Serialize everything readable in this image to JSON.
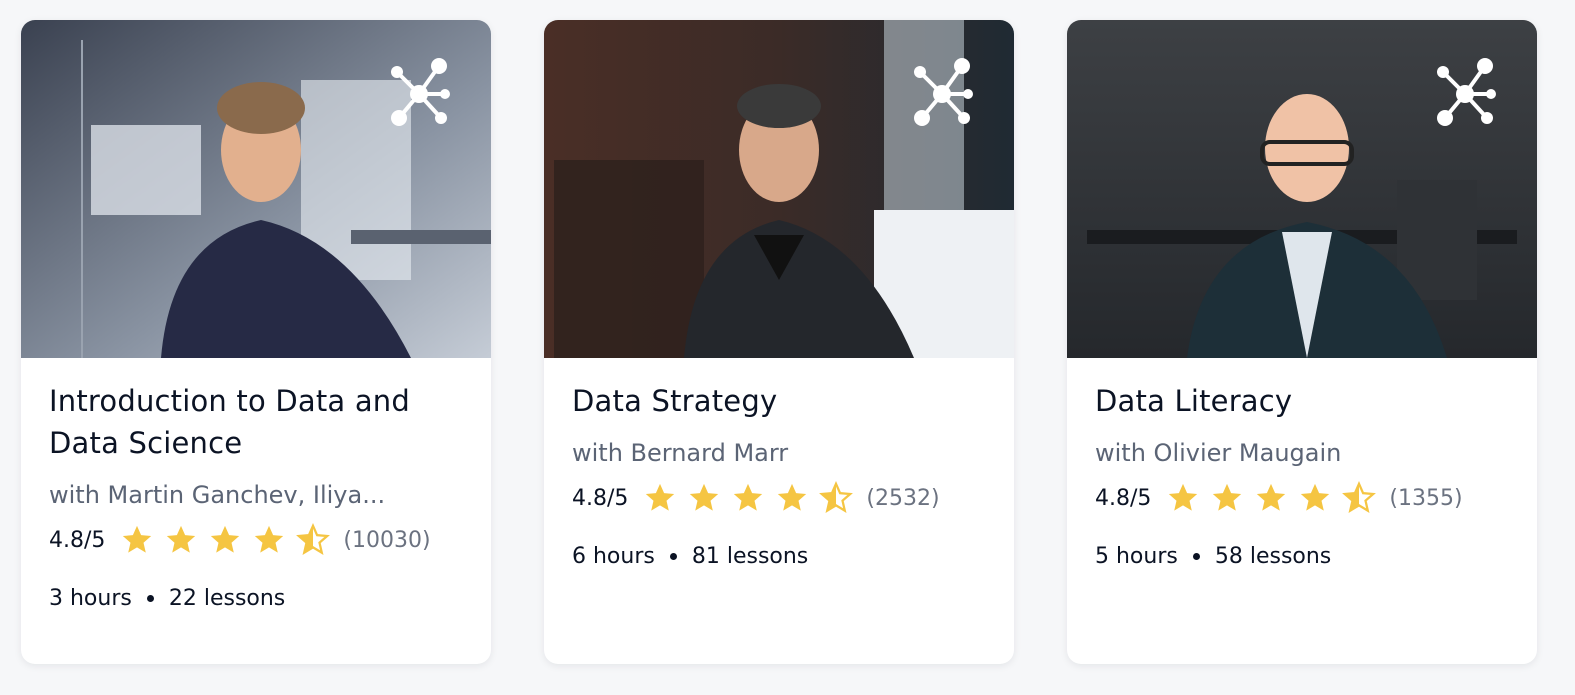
{
  "colors": {
    "star": "#f5c542",
    "background": "#f6f7f9",
    "card": "#ffffff"
  },
  "courses": [
    {
      "title": "Introduction to Data and Data Science",
      "instructor": "with Martin Ganchev, Iliya...",
      "score": "4.8/5",
      "stars": 4.5,
      "count": "(10030)",
      "hours": "3 hours",
      "lessons": "22 lessons",
      "icon": "network-icon"
    },
    {
      "title": "Data Strategy",
      "instructor": "with Bernard Marr",
      "score": "4.8/5",
      "stars": 4.5,
      "count": "(2532)",
      "hours": "6 hours",
      "lessons": "81 lessons",
      "icon": "network-icon"
    },
    {
      "title": "Data Literacy",
      "instructor": "with Olivier Maugain",
      "score": "4.8/5",
      "stars": 4.5,
      "count": "(1355)",
      "hours": "5 hours",
      "lessons": "58 lessons",
      "icon": "network-icon"
    }
  ]
}
